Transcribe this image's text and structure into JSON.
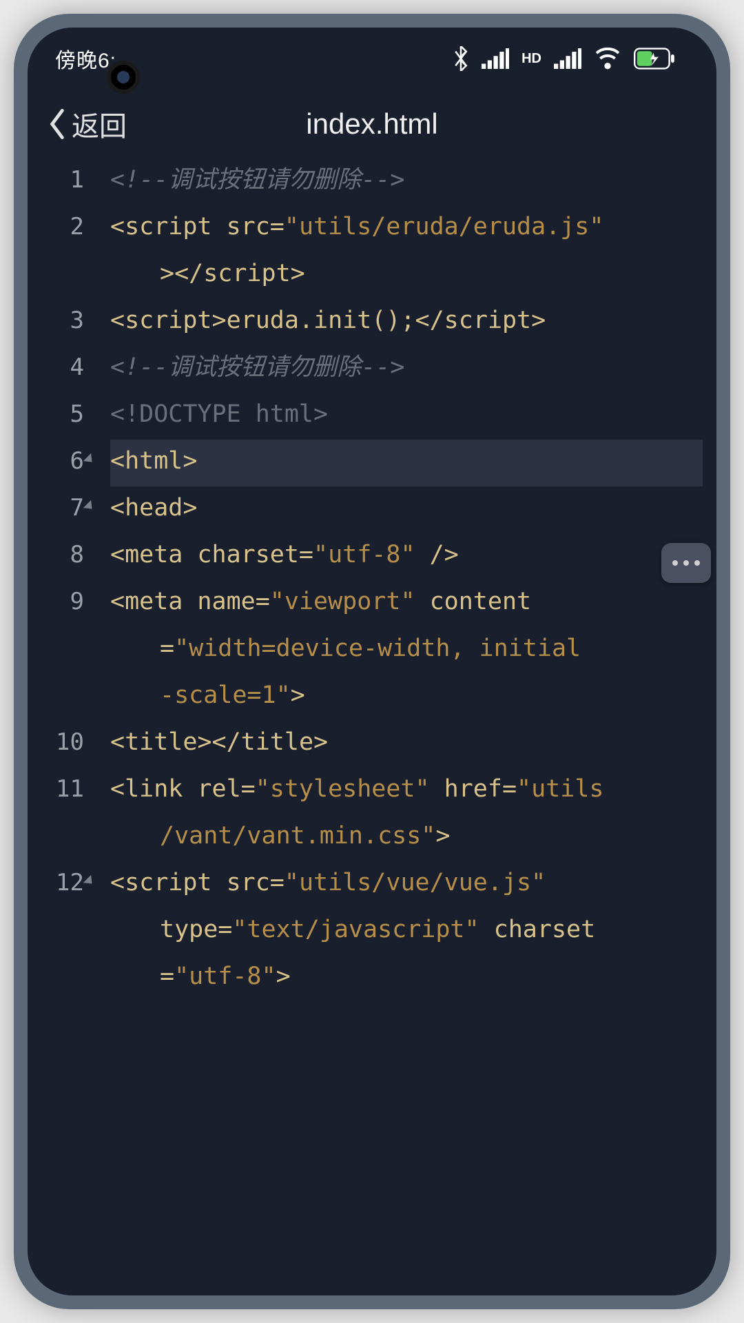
{
  "statusbar": {
    "time": "傍晚6:"
  },
  "titlebar": {
    "back_label": "返回",
    "title": "index.html"
  },
  "editor": {
    "lines": [
      {
        "num": "1",
        "fold": false,
        "active": false
      },
      {
        "num": "2",
        "fold": false,
        "active": false
      },
      {
        "num": "3",
        "fold": false,
        "active": false
      },
      {
        "num": "4",
        "fold": false,
        "active": false
      },
      {
        "num": "5",
        "fold": false,
        "active": false
      },
      {
        "num": "6",
        "fold": true,
        "active": true
      },
      {
        "num": "7",
        "fold": true,
        "active": false
      },
      {
        "num": "8",
        "fold": false,
        "active": false
      },
      {
        "num": "9",
        "fold": false,
        "active": false
      },
      {
        "num": "10",
        "fold": false,
        "active": false
      },
      {
        "num": "11",
        "fold": false,
        "active": false
      },
      {
        "num": "12",
        "fold": true,
        "active": false
      }
    ],
    "code": {
      "l1_comment": "<!--调试按钮请勿删除-->",
      "l2_tag_open": "<script",
      "l2_attr": " src=",
      "l2_str": "\"utils/eruda/eruda.js\"",
      "l2w_close": "></",
      "l2w_tag": "script",
      "l2w_gt": ">",
      "l3_open": "<script>",
      "l3_call": "eruda.init();",
      "l3_close_lt": "</",
      "l3_close_tag": "script",
      "l3_close_gt": ">",
      "l4_comment": "<!--调试按钮请勿删除-->",
      "l5_doctype": "<!DOCTYPE html>",
      "l6_html": "<html>",
      "l7_head": "<head>",
      "l8_open": "<meta",
      "l8_attr": " charset=",
      "l8_str": "\"utf-8\"",
      "l8_close": " />",
      "l9_open": "<meta",
      "l9_name_attr": " name=",
      "l9_name_str": "\"viewport\"",
      "l9_content_attr": " content",
      "l9w1_eq": "=",
      "l9w1_str": "\"width=device-width, initial",
      "l9w2_str": "-scale=1\"",
      "l9w2_gt": ">",
      "l10_open": "<title></",
      "l10_close": "title>",
      "l11_open": "<link",
      "l11_rel_attr": " rel=",
      "l11_rel_str": "\"stylesheet\"",
      "l11_href_attr": " href=",
      "l11_href_str": "\"utils",
      "l11w_str": "/vant/vant.min.css\"",
      "l11w_gt": ">",
      "l12_open": "<script",
      "l12_src_attr": " src=",
      "l12_src_str": "\"utils/vue/vue.js\"",
      "l12w1_type_attr": "type=",
      "l12w1_type_str": "\"text/javascript\"",
      "l12w1_charset_attr": " charset",
      "l12w2_eq": "=",
      "l12w2_str": "\"utf-8\"",
      "l12w2_gt": ">"
    }
  }
}
